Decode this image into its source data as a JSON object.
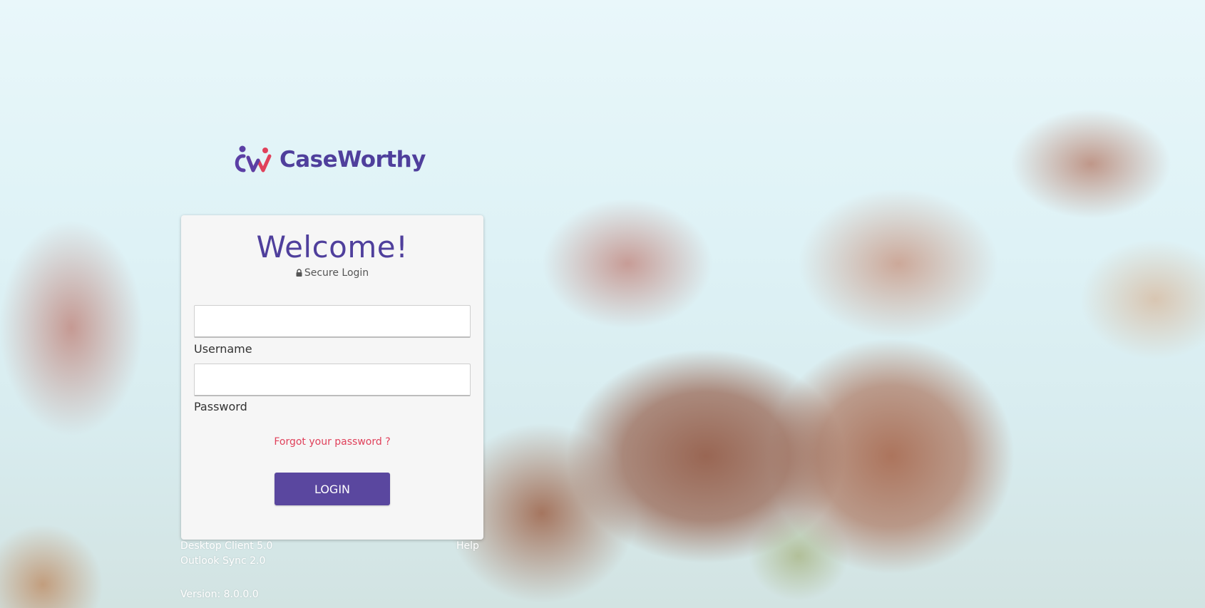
{
  "app": {
    "brand_name": "CaseWorthy",
    "brand_color": "#4f3f9c",
    "brand_accent": "#e0415b",
    "logo_icon": "caseworthy-logo-icon"
  },
  "login_card": {
    "title": "Welcome!",
    "subtitle": "Secure Login",
    "subtitle_icon": "lock-icon",
    "username": {
      "value": "",
      "label": "Username"
    },
    "password": {
      "value": "",
      "label": "Password"
    },
    "forgot_link": "Forgot your password ?",
    "login_button": "LOGIN",
    "button_color": "#5a479f"
  },
  "footer": {
    "desktop_client": "Desktop Client 5.0",
    "outlook_sync": "Outlook Sync 2.0",
    "help": "Help",
    "version": "Version: 8.0.0.0"
  }
}
